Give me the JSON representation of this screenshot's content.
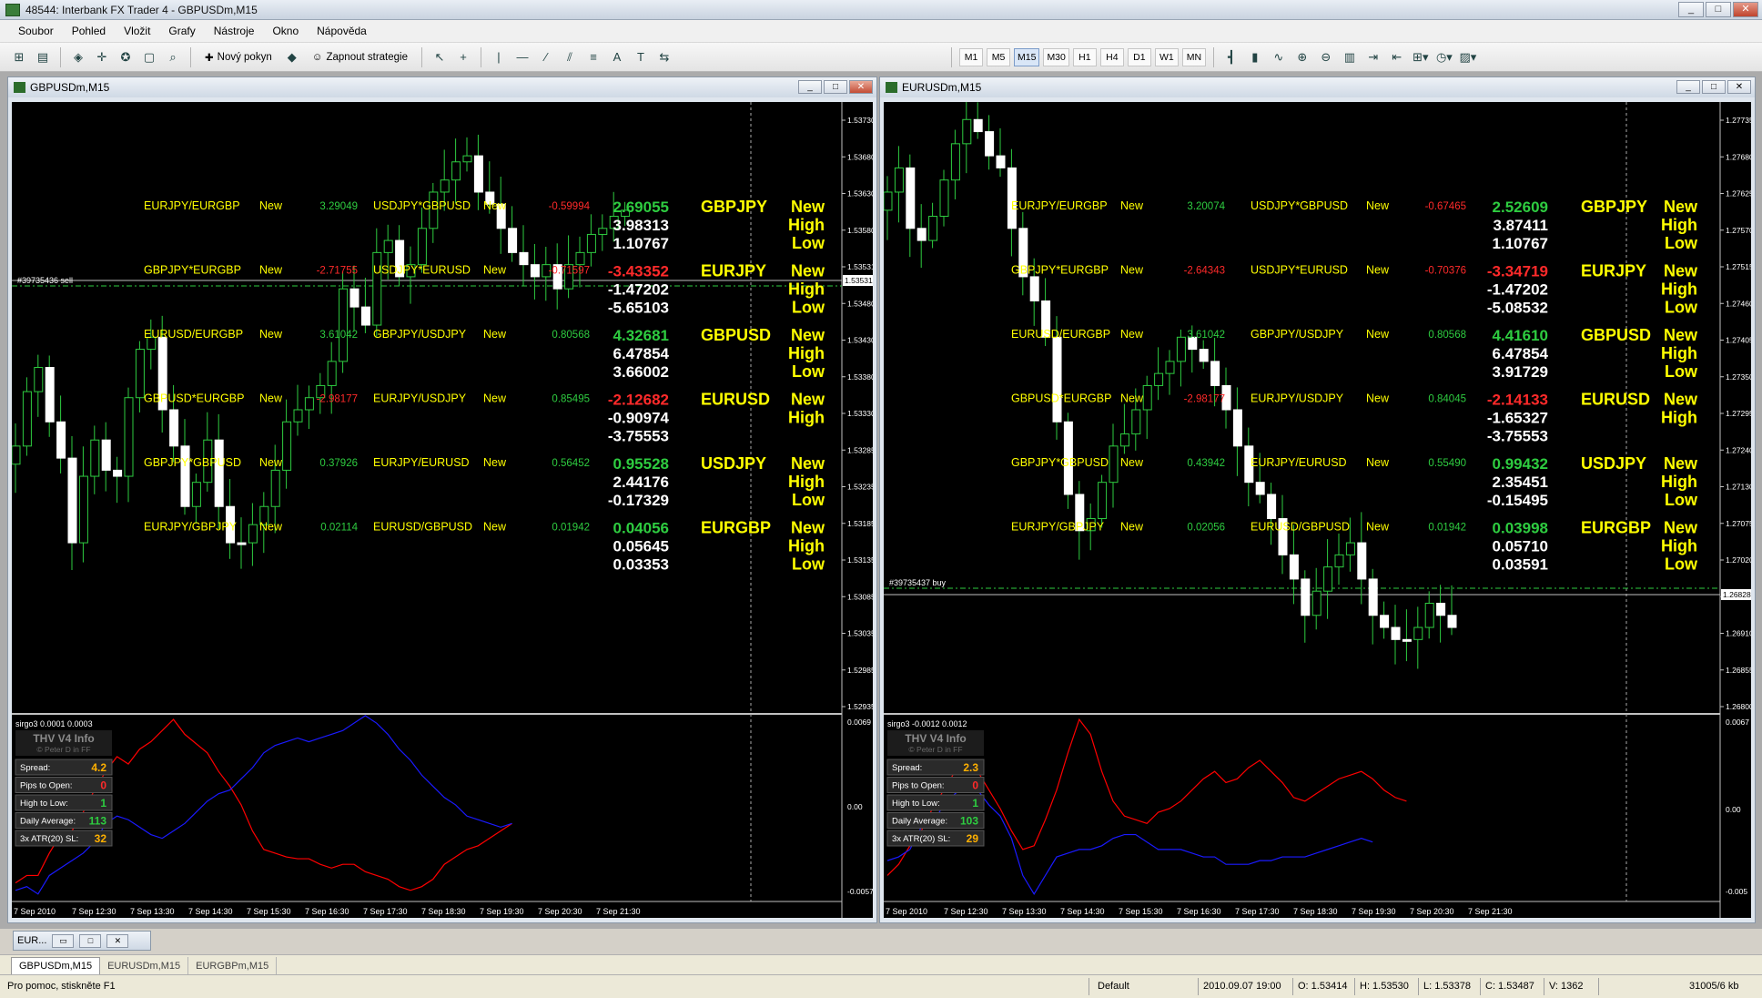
{
  "window": {
    "title": "48544: Interbank FX Trader 4 - GBPUSDm,M15",
    "min": "_",
    "max": "□",
    "close": "✕"
  },
  "menu": [
    "Soubor",
    "Pohled",
    "Vložit",
    "Grafy",
    "Nástroje",
    "Okno",
    "Nápověda"
  ],
  "toolbar": {
    "new_order": "Nový pokyn",
    "strategy": "Zapnout strategie",
    "timeframes": [
      "M1",
      "M5",
      "M15",
      "M30",
      "H1",
      "H4",
      "D1",
      "W1",
      "MN"
    ],
    "active_timeframe": "M15"
  },
  "charts": [
    {
      "title": "GBPUSDm,M15",
      "price_axis": [
        "1.53730",
        "1.53680",
        "1.53630",
        "1.53580",
        "1.53531",
        "1.53480",
        "1.53430",
        "1.53380",
        "1.53330",
        "1.53285",
        "1.53235",
        "1.53185",
        "1.53135",
        "1.53085",
        "1.53035",
        "1.52985",
        "1.52935"
      ],
      "current_price": "1.53531",
      "order_label": "#39735436 sell",
      "ind_axis": [
        "0.0069",
        "0.00",
        "-0.0057"
      ],
      "indicator_label": "sirgo3 0.0001 0.0003",
      "time_axis": [
        "7 Sep 2010",
        "7 Sep 12:30",
        "7 Sep 13:30",
        "7 Sep 14:30",
        "7 Sep 15:30",
        "7 Sep 16:30",
        "7 Sep 17:30",
        "7 Sep 18:30",
        "7 Sep 19:30",
        "7 Sep 20:30",
        "7 Sep 21:30"
      ],
      "info": {
        "title": "THV  V4  Info",
        "sub": "© Peter D in FF",
        "spread_label": "Spread:",
        "spread": "4.2",
        "pips_label": "Pips to Open:",
        "pips": "0",
        "hl_label": "High to Low:",
        "hl": "1",
        "avg_label": "Daily Average:",
        "avg": "113",
        "atr_label": "3x ATR(20) SL:",
        "atr": "32"
      },
      "crosses": [
        {
          "l1": "EURJPY/EURGBP",
          "n1": "New",
          "v1": "3.29049",
          "l2": "USDJPY*GBPUSD",
          "n2": "New",
          "v2": "-0.59994"
        },
        {
          "l1": "GBPJPY*EURGBP",
          "n1": "New",
          "v1": "-2.71755",
          "l2": "USDJPY*EURUSD",
          "n2": "New",
          "v2": "-0.71597"
        },
        {
          "l1": "EURUSD/EURGBP",
          "n1": "New",
          "v1": "3.61042",
          "l2": "GBPJPY/USDJPY",
          "n2": "New",
          "v2": "0.80568"
        },
        {
          "l1": "GBPUSD*EURGBP",
          "n1": "New",
          "v1": "-2.98177",
          "l2": "EURJPY/USDJPY",
          "n2": "New",
          "v2": "0.85495"
        },
        {
          "l1": "GBPJPY*GBPUSD",
          "n1": "New",
          "v1": "0.37926",
          "l2": "EURJPY/EURUSD",
          "n2": "New",
          "v2": "0.56452"
        },
        {
          "l1": "EURJPY/GBPJPY",
          "n1": "New",
          "v1": "0.02114",
          "l2": "EURUSD/GBPUSD",
          "n2": "New",
          "v2": "0.01942"
        }
      ],
      "pairs": [
        {
          "name": "GBPJPY",
          "v": [
            "2.69055",
            "3.98313",
            "1.10767"
          ],
          "c": [
            "#2ecc40",
            "#ffffff",
            "#ffffff"
          ],
          "tags": [
            "New",
            "High",
            "Low"
          ]
        },
        {
          "name": "EURJPY",
          "v": [
            "-3.43352",
            "-1.47202",
            "-5.65103"
          ],
          "c": [
            "#ff2a2a",
            "#ffffff",
            "#ffffff"
          ],
          "tags": [
            "New",
            "High",
            "Low"
          ]
        },
        {
          "name": "GBPUSD",
          "v": [
            "4.32681",
            "6.47854",
            "3.66002"
          ],
          "c": [
            "#2ecc40",
            "#ffffff",
            "#ffffff"
          ],
          "tags": [
            "New",
            "High",
            "Low"
          ]
        },
        {
          "name": "EURUSD",
          "v": [
            "-2.12682",
            "-0.90974",
            "-3.75553"
          ],
          "c": [
            "#ff2a2a",
            "#ffffff",
            "#ffffff"
          ],
          "tags": [
            "New",
            "High",
            ""
          ]
        },
        {
          "name": "USDJPY",
          "v": [
            "0.95528",
            "2.44176",
            "-0.17329"
          ],
          "c": [
            "#2ecc40",
            "#ffffff",
            "#ffffff"
          ],
          "tags": [
            "New",
            "High",
            "Low"
          ]
        },
        {
          "name": "EURGBP",
          "v": [
            "0.04056",
            "0.05645",
            "0.03353"
          ],
          "c": [
            "#2ecc40",
            "#ffffff",
            "#ffffff"
          ],
          "tags": [
            "New",
            "High",
            "Low"
          ]
        }
      ]
    },
    {
      "title": "EURUSDm,M15",
      "price_axis": [
        "1.27735",
        "1.27680",
        "1.27625",
        "1.27570",
        "1.27515",
        "1.27460",
        "1.27405",
        "1.27350",
        "1.27295",
        "1.27240",
        "1.27130",
        "1.27075",
        "1.27020",
        "1.26965",
        "1.26910",
        "1.26855",
        "1.26800"
      ],
      "current_price": "1.26828",
      "order_label": "#39735437 buy",
      "ind_axis": [
        "0.0067",
        "0.00",
        "-0.005"
      ],
      "indicator_label": "sirgo3 -0.0012 0.0012",
      "time_axis": [
        "7 Sep 2010",
        "7 Sep 12:30",
        "7 Sep 13:30",
        "7 Sep 14:30",
        "7 Sep 15:30",
        "7 Sep 16:30",
        "7 Sep 17:30",
        "7 Sep 18:30",
        "7 Sep 19:30",
        "7 Sep 20:30",
        "7 Sep 21:30"
      ],
      "info": {
        "title": "THV  V4  Info",
        "sub": "© Peter D in FF",
        "spread_label": "Spread:",
        "spread": "2.3",
        "pips_label": "Pips to Open:",
        "pips": "0",
        "hl_label": "High to Low:",
        "hl": "1",
        "avg_label": "Daily Average:",
        "avg": "103",
        "atr_label": "3x ATR(20) SL:",
        "atr": "29"
      },
      "crosses": [
        {
          "l1": "EURJPY/EURGBP",
          "n1": "New",
          "v1": "3.20074",
          "l2": "USDJPY*GBPUSD",
          "n2": "New",
          "v2": "-0.67465"
        },
        {
          "l1": "GBPJPY*EURGBP",
          "n1": "New",
          "v1": "-2.64343",
          "l2": "USDJPY*EURUSD",
          "n2": "New",
          "v2": "-0.70376"
        },
        {
          "l1": "EURUSD/EURGBP",
          "n1": "New",
          "v1": "3.61042",
          "l2": "GBPJPY/USDJPY",
          "n2": "New",
          "v2": "0.80568"
        },
        {
          "l1": "GBPUSD*EURGBP",
          "n1": "New",
          "v1": "-2.98177",
          "l2": "EURJPY/USDJPY",
          "n2": "New",
          "v2": "0.84045"
        },
        {
          "l1": "GBPJPY*GBPUSD",
          "n1": "New",
          "v1": "0.43942",
          "l2": "EURJPY/EURUSD",
          "n2": "New",
          "v2": "0.55490"
        },
        {
          "l1": "EURJPY/GBPJPY",
          "n1": "New",
          "v1": "0.02056",
          "l2": "EURUSD/GBPUSD",
          "n2": "New",
          "v2": "0.01942"
        }
      ],
      "pairs": [
        {
          "name": "GBPJPY",
          "v": [
            "2.52609",
            "3.87411",
            "1.10767"
          ],
          "c": [
            "#2ecc40",
            "#ffffff",
            "#ffffff"
          ],
          "tags": [
            "New",
            "High",
            "Low"
          ]
        },
        {
          "name": "EURJPY",
          "v": [
            "-3.34719",
            "-1.47202",
            "-5.08532"
          ],
          "c": [
            "#ff2a2a",
            "#ffffff",
            "#ffffff"
          ],
          "tags": [
            "New",
            "High",
            "Low"
          ]
        },
        {
          "name": "GBPUSD",
          "v": [
            "4.41610",
            "6.47854",
            "3.91729"
          ],
          "c": [
            "#2ecc40",
            "#ffffff",
            "#ffffff"
          ],
          "tags": [
            "New",
            "High",
            "Low"
          ]
        },
        {
          "name": "EURUSD",
          "v": [
            "-2.14133",
            "-1.65327",
            "-3.75553"
          ],
          "c": [
            "#ff2a2a",
            "#ffffff",
            "#ffffff"
          ],
          "tags": [
            "New",
            "High",
            ""
          ]
        },
        {
          "name": "USDJPY",
          "v": [
            "0.99432",
            "2.35451",
            "-0.15495"
          ],
          "c": [
            "#2ecc40",
            "#ffffff",
            "#ffffff"
          ],
          "tags": [
            "New",
            "High",
            "Low"
          ]
        },
        {
          "name": "EURGBP",
          "v": [
            "0.03998",
            "0.05710",
            "0.03591"
          ],
          "c": [
            "#2ecc40",
            "#ffffff",
            "#ffffff"
          ],
          "tags": [
            "New",
            "High",
            "Low"
          ]
        }
      ]
    }
  ],
  "minimized": {
    "title": "EUR..."
  },
  "doc_tabs": [
    "GBPUSDm,M15",
    "EURUSDm,M15",
    "EURGBPm,M15"
  ],
  "status": {
    "help": "Pro pomoc, stiskněte F1",
    "profile": "Default",
    "time": "2010.09.07 19:00",
    "open": "O: 1.53414",
    "high": "H: 1.53530",
    "low": "L: 1.53378",
    "close": "C: 1.53487",
    "volume": "V: 1362",
    "traffic": "31005/6 kb"
  },
  "colors": {
    "bull": "#2ecc40",
    "bear": "#ff2a2a",
    "label": "#ffff00",
    "ind_red": "#ff0000",
    "ind_blue": "#1a1aff"
  }
}
